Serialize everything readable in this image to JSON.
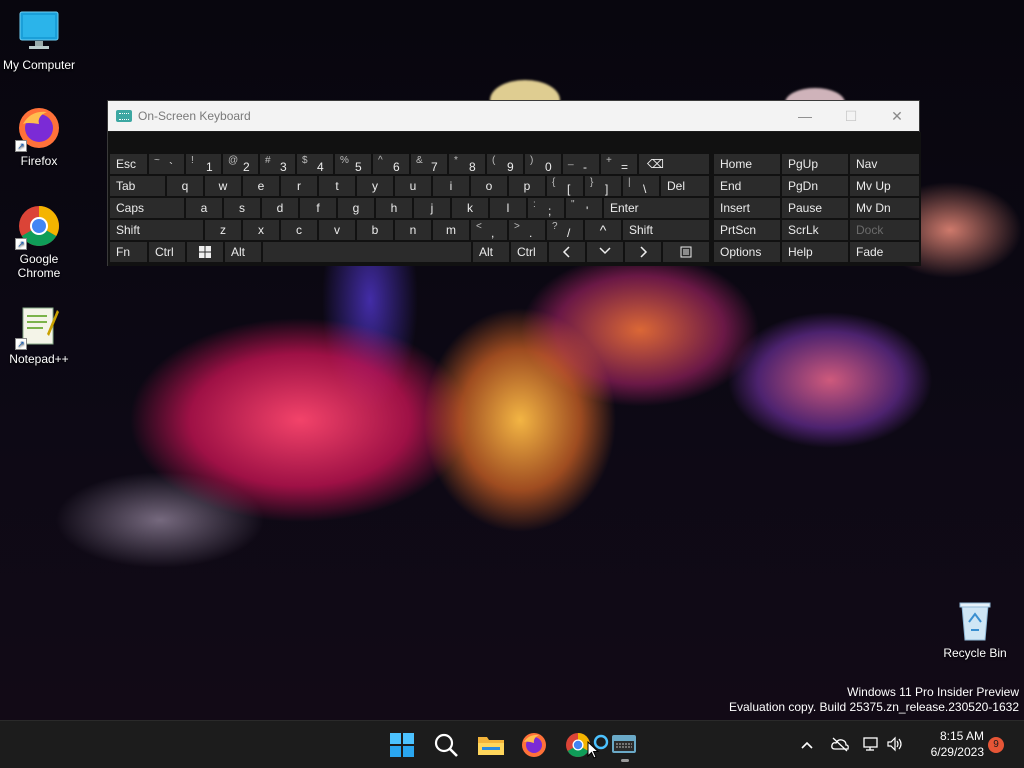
{
  "desktop": {
    "icons": [
      {
        "label": "My Computer"
      },
      {
        "label": "Firefox"
      },
      {
        "label": "Google Chrome"
      },
      {
        "label": "Notepad++"
      },
      {
        "label": "Recycle Bin"
      }
    ],
    "watermark": {
      "line1": "Windows 11 Pro Insider Preview",
      "line2": "Evaluation copy. Build 25375.zn_release.230520-1632"
    }
  },
  "osk": {
    "title": "On-Screen Keyboard",
    "controls": {
      "minimize": "—",
      "maximize": "☐",
      "close": "✕"
    },
    "rows": {
      "r1": [
        {
          "label": "Esc"
        },
        {
          "shift": "~",
          "main": "`"
        },
        {
          "shift": "!",
          "main": "1"
        },
        {
          "shift": "@",
          "main": "2"
        },
        {
          "shift": "#",
          "main": "3"
        },
        {
          "shift": "$",
          "main": "4"
        },
        {
          "shift": "%",
          "main": "5"
        },
        {
          "shift": "^",
          "main": "6"
        },
        {
          "shift": "&",
          "main": "7"
        },
        {
          "shift": "*",
          "main": "8"
        },
        {
          "shift": "(",
          "main": "9"
        },
        {
          "shift": ")",
          "main": "0"
        },
        {
          "shift": "_",
          "main": "-"
        },
        {
          "shift": "+",
          "main": "="
        },
        {
          "label": "⌫"
        }
      ],
      "r2": [
        {
          "label": "Tab"
        },
        {
          "label": "q"
        },
        {
          "label": "w"
        },
        {
          "label": "e"
        },
        {
          "label": "r"
        },
        {
          "label": "t"
        },
        {
          "label": "y"
        },
        {
          "label": "u"
        },
        {
          "label": "i"
        },
        {
          "label": "o"
        },
        {
          "label": "p"
        },
        {
          "shift": "{",
          "main": "["
        },
        {
          "shift": "}",
          "main": "]"
        },
        {
          "shift": "|",
          "main": "\\"
        },
        {
          "label": "Del"
        }
      ],
      "r3": [
        {
          "label": "Caps"
        },
        {
          "label": "a"
        },
        {
          "label": "s"
        },
        {
          "label": "d"
        },
        {
          "label": "f"
        },
        {
          "label": "g"
        },
        {
          "label": "h"
        },
        {
          "label": "j"
        },
        {
          "label": "k"
        },
        {
          "label": "l"
        },
        {
          "shift": ":",
          "main": ";"
        },
        {
          "shift": "\"",
          "main": "'"
        },
        {
          "label": "Enter"
        }
      ],
      "r4": [
        {
          "label": "Shift"
        },
        {
          "label": "z"
        },
        {
          "label": "x"
        },
        {
          "label": "c"
        },
        {
          "label": "v"
        },
        {
          "label": "b"
        },
        {
          "label": "n"
        },
        {
          "label": "m"
        },
        {
          "shift": "<",
          "main": ","
        },
        {
          "shift": ">",
          "main": "."
        },
        {
          "shift": "?",
          "main": "/"
        },
        {
          "label": "^"
        },
        {
          "label": "Shift"
        }
      ],
      "r5": [
        {
          "label": "Fn"
        },
        {
          "label": "Ctrl"
        },
        {
          "label": "win-logo-icon"
        },
        {
          "label": "Alt"
        },
        {
          "label": ""
        },
        {
          "label": "Alt"
        },
        {
          "label": "Ctrl"
        },
        {
          "label": "<"
        },
        {
          "label": "v"
        },
        {
          "label": ">"
        },
        {
          "label": "menu-icon"
        }
      ]
    },
    "nav": [
      [
        "Home",
        "PgUp",
        "Nav"
      ],
      [
        "End",
        "PgDn",
        "Mv Up"
      ],
      [
        "Insert",
        "Pause",
        "Mv Dn"
      ],
      [
        "PrtScn",
        "ScrLk",
        "Dock"
      ],
      [
        "Options",
        "Help",
        "Fade"
      ]
    ]
  },
  "taskbar": {
    "time": "8:15 AM",
    "date": "6/29/2023",
    "notification_count": "9",
    "apps": [
      "start-icon",
      "search-icon",
      "file-explorer-icon",
      "firefox-icon",
      "chrome-icon",
      "cortana-icon",
      "osk-icon"
    ]
  }
}
